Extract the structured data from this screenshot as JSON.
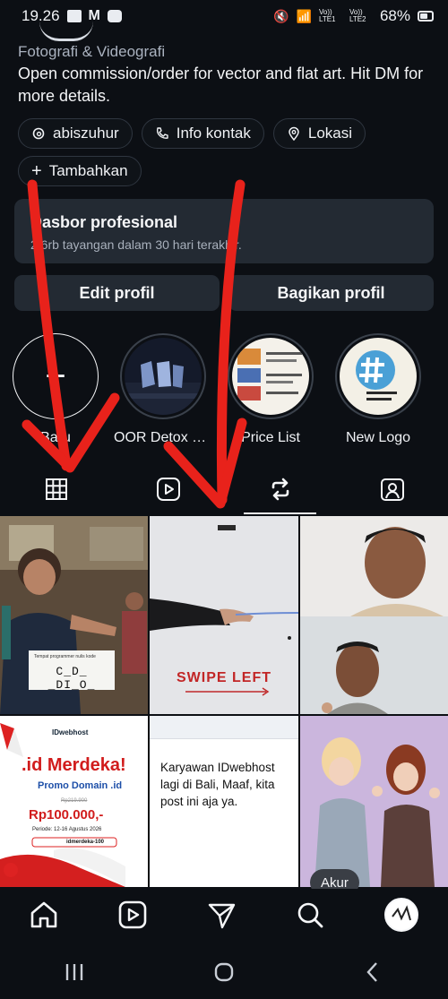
{
  "status_bar": {
    "time": "19.26",
    "battery": "68%",
    "net1": "Vo)) LTE1",
    "net2": "Vo)) LTE2"
  },
  "profile": {
    "category": "Fotografi & Videografi",
    "bio": "Open commission/order for vector and flat art. Hit DM for more details."
  },
  "chips": {
    "threads": "abiszuhur",
    "contact": "Info kontak",
    "location": "Lokasi",
    "add": "Tambahkan"
  },
  "dashboard": {
    "title": "Dasbor profesional",
    "subtitle": "2,6rb tayangan dalam 30 hari terakhir."
  },
  "buttons": {
    "edit": "Edit profil",
    "share": "Bagikan profil"
  },
  "highlights": [
    {
      "label": "Baru"
    },
    {
      "label": "OOR Detox JK..."
    },
    {
      "label": "Price List"
    },
    {
      "label": "New Logo"
    }
  ],
  "grid": {
    "post1_card": "C_D_ _DI_O_",
    "post1_caption": "Tempat programmer nulis kode",
    "post2_text": "SWIPE LEFT",
    "post4_brand": "IDwebhost",
    "post4_title": ".id Merdeka!",
    "post4_sub": "Promo Domain .id",
    "post4_old": "Rp219.900",
    "post4_price": "Rp100.000,-",
    "post4_period": "Periode: 12-16 Agustus 2026",
    "post4_code": "idmerdeka-100",
    "post5_text": "Karyawan IDwebhost lagi di Bali, Maaf, kita post ini aja ya.",
    "post6_badge": "Akur"
  },
  "colors": {
    "bg": "#0c0f14",
    "card": "#232a33",
    "text": "#f5f6f8",
    "arrow": "#e8221b"
  }
}
